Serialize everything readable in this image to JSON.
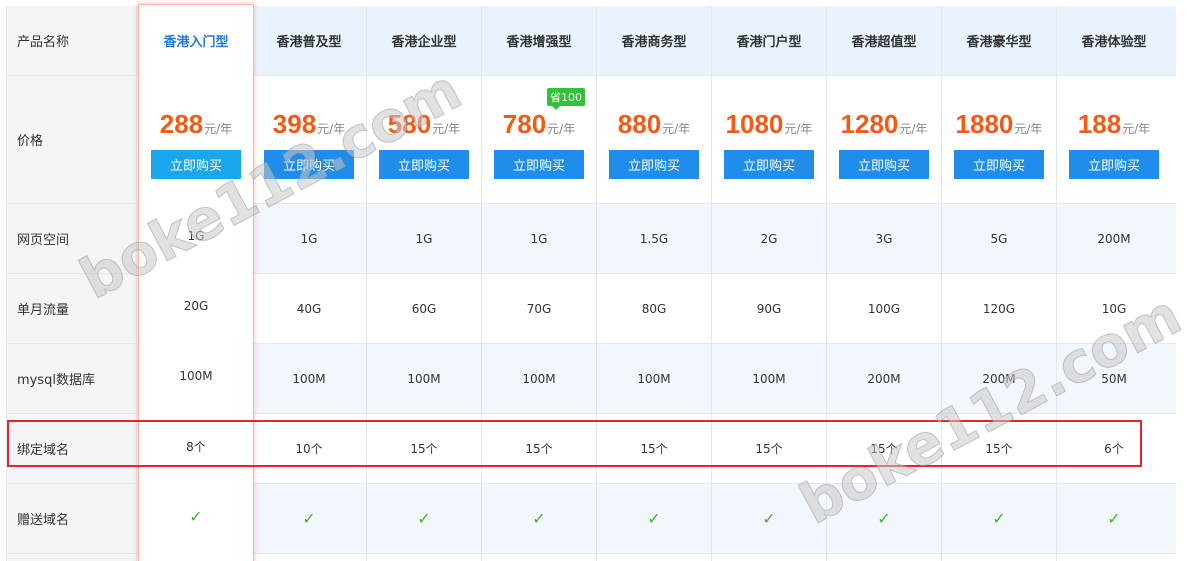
{
  "row_labels": {
    "product_name": "产品名称",
    "price": "价格",
    "web_space": "网页空间",
    "monthly_traffic": "单月流量",
    "mysql": "mysql数据库",
    "bind_domain": "绑定域名",
    "gift_domain": "赠送域名"
  },
  "buy_label": "立即购买",
  "price_unit": "元/年",
  "save_badge": "省100",
  "check_mark": "✓",
  "watermark": "boke112.com",
  "plans": [
    {
      "name": "香港入门型",
      "price": "288",
      "space": "1G",
      "traffic": "20G",
      "mysql": "100M",
      "domains": "8个"
    },
    {
      "name": "香港普及型",
      "price": "398",
      "space": "1G",
      "traffic": "40G",
      "mysql": "100M",
      "domains": "10个"
    },
    {
      "name": "香港企业型",
      "price": "580",
      "space": "1G",
      "traffic": "60G",
      "mysql": "100M",
      "domains": "15个"
    },
    {
      "name": "香港增强型",
      "price": "780",
      "space": "1G",
      "traffic": "70G",
      "mysql": "100M",
      "domains": "15个"
    },
    {
      "name": "香港商务型",
      "price": "880",
      "space": "1.5G",
      "traffic": "80G",
      "mysql": "100M",
      "domains": "15个"
    },
    {
      "name": "香港门户型",
      "price": "1080",
      "space": "2G",
      "traffic": "90G",
      "mysql": "100M",
      "domains": "15个"
    },
    {
      "name": "香港超值型",
      "price": "1280",
      "space": "3G",
      "traffic": "100G",
      "mysql": "200M",
      "domains": "15个"
    },
    {
      "name": "香港豪华型",
      "price": "1880",
      "space": "5G",
      "traffic": "120G",
      "mysql": "200M",
      "domains": "15个"
    },
    {
      "name": "香港体验型",
      "price": "188",
      "space": "200M",
      "traffic": "10G",
      "mysql": "50M",
      "domains": "6个"
    }
  ],
  "colors": {
    "price": "#f25a18",
    "button": "#1f8de9",
    "highlight_button": "#1aa6ec",
    "check": "#4caf2c",
    "badge": "#34c13a",
    "red_box": "#e8232b",
    "header_bg": "#e8f3fd"
  }
}
